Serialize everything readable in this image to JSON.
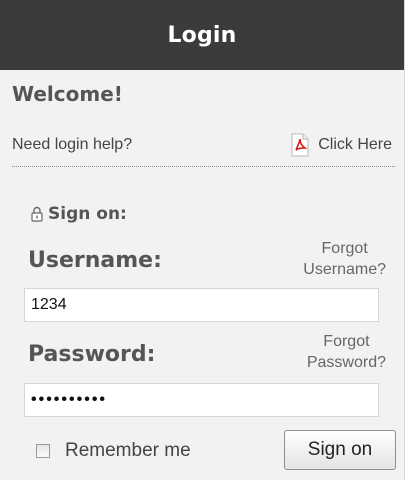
{
  "header": {
    "title": "Login"
  },
  "welcome": {
    "heading": "Welcome!"
  },
  "help": {
    "text": "Need login help?",
    "link_label": "Click Here",
    "link_icon": "pdf-icon"
  },
  "signon": {
    "label": "Sign on:",
    "icon": "lock-icon"
  },
  "username": {
    "label": "Username:",
    "forgot_line1": "Forgot",
    "forgot_line2": "Username?",
    "value": "1234"
  },
  "password": {
    "label": "Password:",
    "forgot_line1": "Forgot",
    "forgot_line2": "Password?",
    "value_masked": "••••••••••"
  },
  "remember": {
    "label": "Remember me",
    "checked": false
  },
  "submit": {
    "label": "Sign on"
  }
}
